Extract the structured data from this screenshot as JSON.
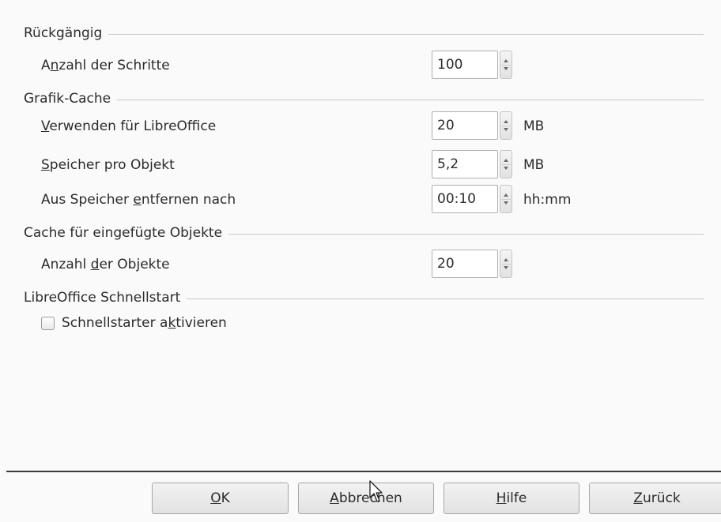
{
  "undo": {
    "title": "Rückgängig",
    "steps_label": [
      "A",
      "n",
      "zahl der Schritte"
    ],
    "steps_value": "100"
  },
  "graphics_cache": {
    "title": "Grafik-Cache",
    "use_label": [
      "",
      "V",
      "erwenden für LibreOffice"
    ],
    "use_value": "20",
    "use_unit": "MB",
    "per_object_label": [
      "",
      "S",
      "peicher pro Objekt"
    ],
    "per_object_value": "5,2",
    "per_object_unit": "MB",
    "remove_label": [
      "Aus Speicher ",
      "e",
      "ntfernen nach"
    ],
    "remove_value": "00:10",
    "remove_unit": "hh:mm"
  },
  "object_cache": {
    "title": "Cache für eingefügte Objekte",
    "count_label": [
      "Anzahl ",
      "d",
      "er Objekte"
    ],
    "count_value": "20"
  },
  "quickstart": {
    "title": "LibreOffice Schnellstart",
    "checkbox_label": [
      "Schnellstarter a",
      "k",
      "tivieren"
    ],
    "checked": false
  },
  "buttons": {
    "ok": [
      "",
      "O",
      "K"
    ],
    "cancel": [
      "",
      "A",
      "bbrechen"
    ],
    "help": [
      "",
      "H",
      "ilfe"
    ],
    "back": [
      "",
      "Z",
      "urück"
    ]
  }
}
